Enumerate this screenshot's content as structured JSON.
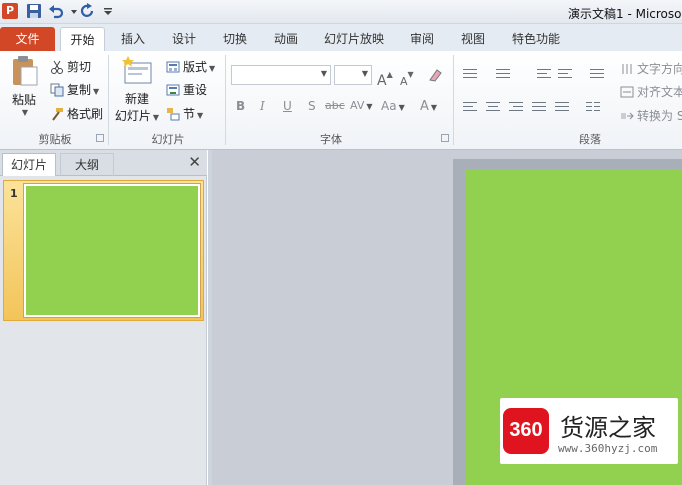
{
  "titlebar": {
    "app_icon_letter": "P",
    "document_title": "演示文稿1 - Microso"
  },
  "tabs": [
    {
      "label": "文件"
    },
    {
      "label": "开始"
    },
    {
      "label": "插入"
    },
    {
      "label": "设计"
    },
    {
      "label": "切换"
    },
    {
      "label": "动画"
    },
    {
      "label": "幻灯片放映"
    },
    {
      "label": "审阅"
    },
    {
      "label": "视图"
    },
    {
      "label": "特色功能"
    }
  ],
  "ribbon": {
    "clipboard": {
      "paste": "粘贴",
      "cut": "剪切",
      "copy": "复制",
      "format_painter": "格式刷",
      "group_label": "剪贴板"
    },
    "slides": {
      "new_slide_line1": "新建",
      "new_slide_line2": "幻灯片",
      "layout": "版式",
      "reset": "重设",
      "section": "节",
      "group_label": "幻灯片"
    },
    "font": {
      "bold": "B",
      "italic": "I",
      "underline": "U",
      "shadow": "S",
      "strikethrough": "abc",
      "spacing": "AV",
      "change_case": "Aa",
      "font_color": "A",
      "grow": "A",
      "shrink": "A",
      "group_label": "字体"
    },
    "paragraph": {
      "text_direction": "文字方向",
      "align_text": "对齐文本",
      "convert_smartart": "转换为 S",
      "group_label": "段落"
    }
  },
  "slide_panel": {
    "tab_slides": "幻灯片",
    "tab_outline": "大纲",
    "close": "✕",
    "slide_number": "1"
  },
  "colors": {
    "slide_background": "#92d050",
    "file_tab": "#d24726"
  },
  "watermark": {
    "badge": "360",
    "title": "货源之家",
    "url": "www.360hyzj.com"
  }
}
